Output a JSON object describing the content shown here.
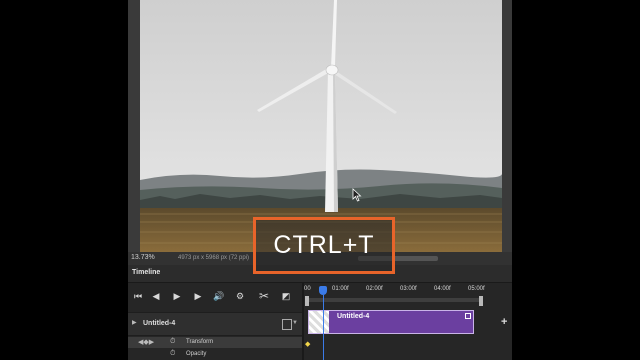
{
  "status_bar": {
    "zoom": "13.73%",
    "doc_info": "4973 px x 5968 px (72 ppi)"
  },
  "timeline": {
    "panel_title": "Timeline",
    "ruler_marks": [
      "00",
      "01:00f",
      "02:00f",
      "03:00f",
      "04:00f",
      "05:00f"
    ],
    "layer_name": "Untitled-4",
    "clip_title": "Untitled-4",
    "properties": [
      "Transform",
      "Opacity"
    ]
  },
  "controls": [
    {
      "name": "go-to-first-frame",
      "icon": "skip-back-icon"
    },
    {
      "name": "previous-frame",
      "icon": "step-back-icon"
    },
    {
      "name": "play",
      "icon": "play-icon"
    },
    {
      "name": "next-frame",
      "icon": "step-forward-icon"
    },
    {
      "name": "audio",
      "icon": "speaker-icon"
    },
    {
      "name": "settings",
      "icon": "gear-icon"
    },
    {
      "name": "split",
      "icon": "scissors-icon"
    },
    {
      "name": "transition",
      "icon": "transition-icon"
    }
  ],
  "overlay": {
    "shortcut": "CTRL+T",
    "accent_color": "#e8642a"
  },
  "colors": {
    "clip": "#6b3fa0",
    "playhead": "#3b7be8"
  }
}
